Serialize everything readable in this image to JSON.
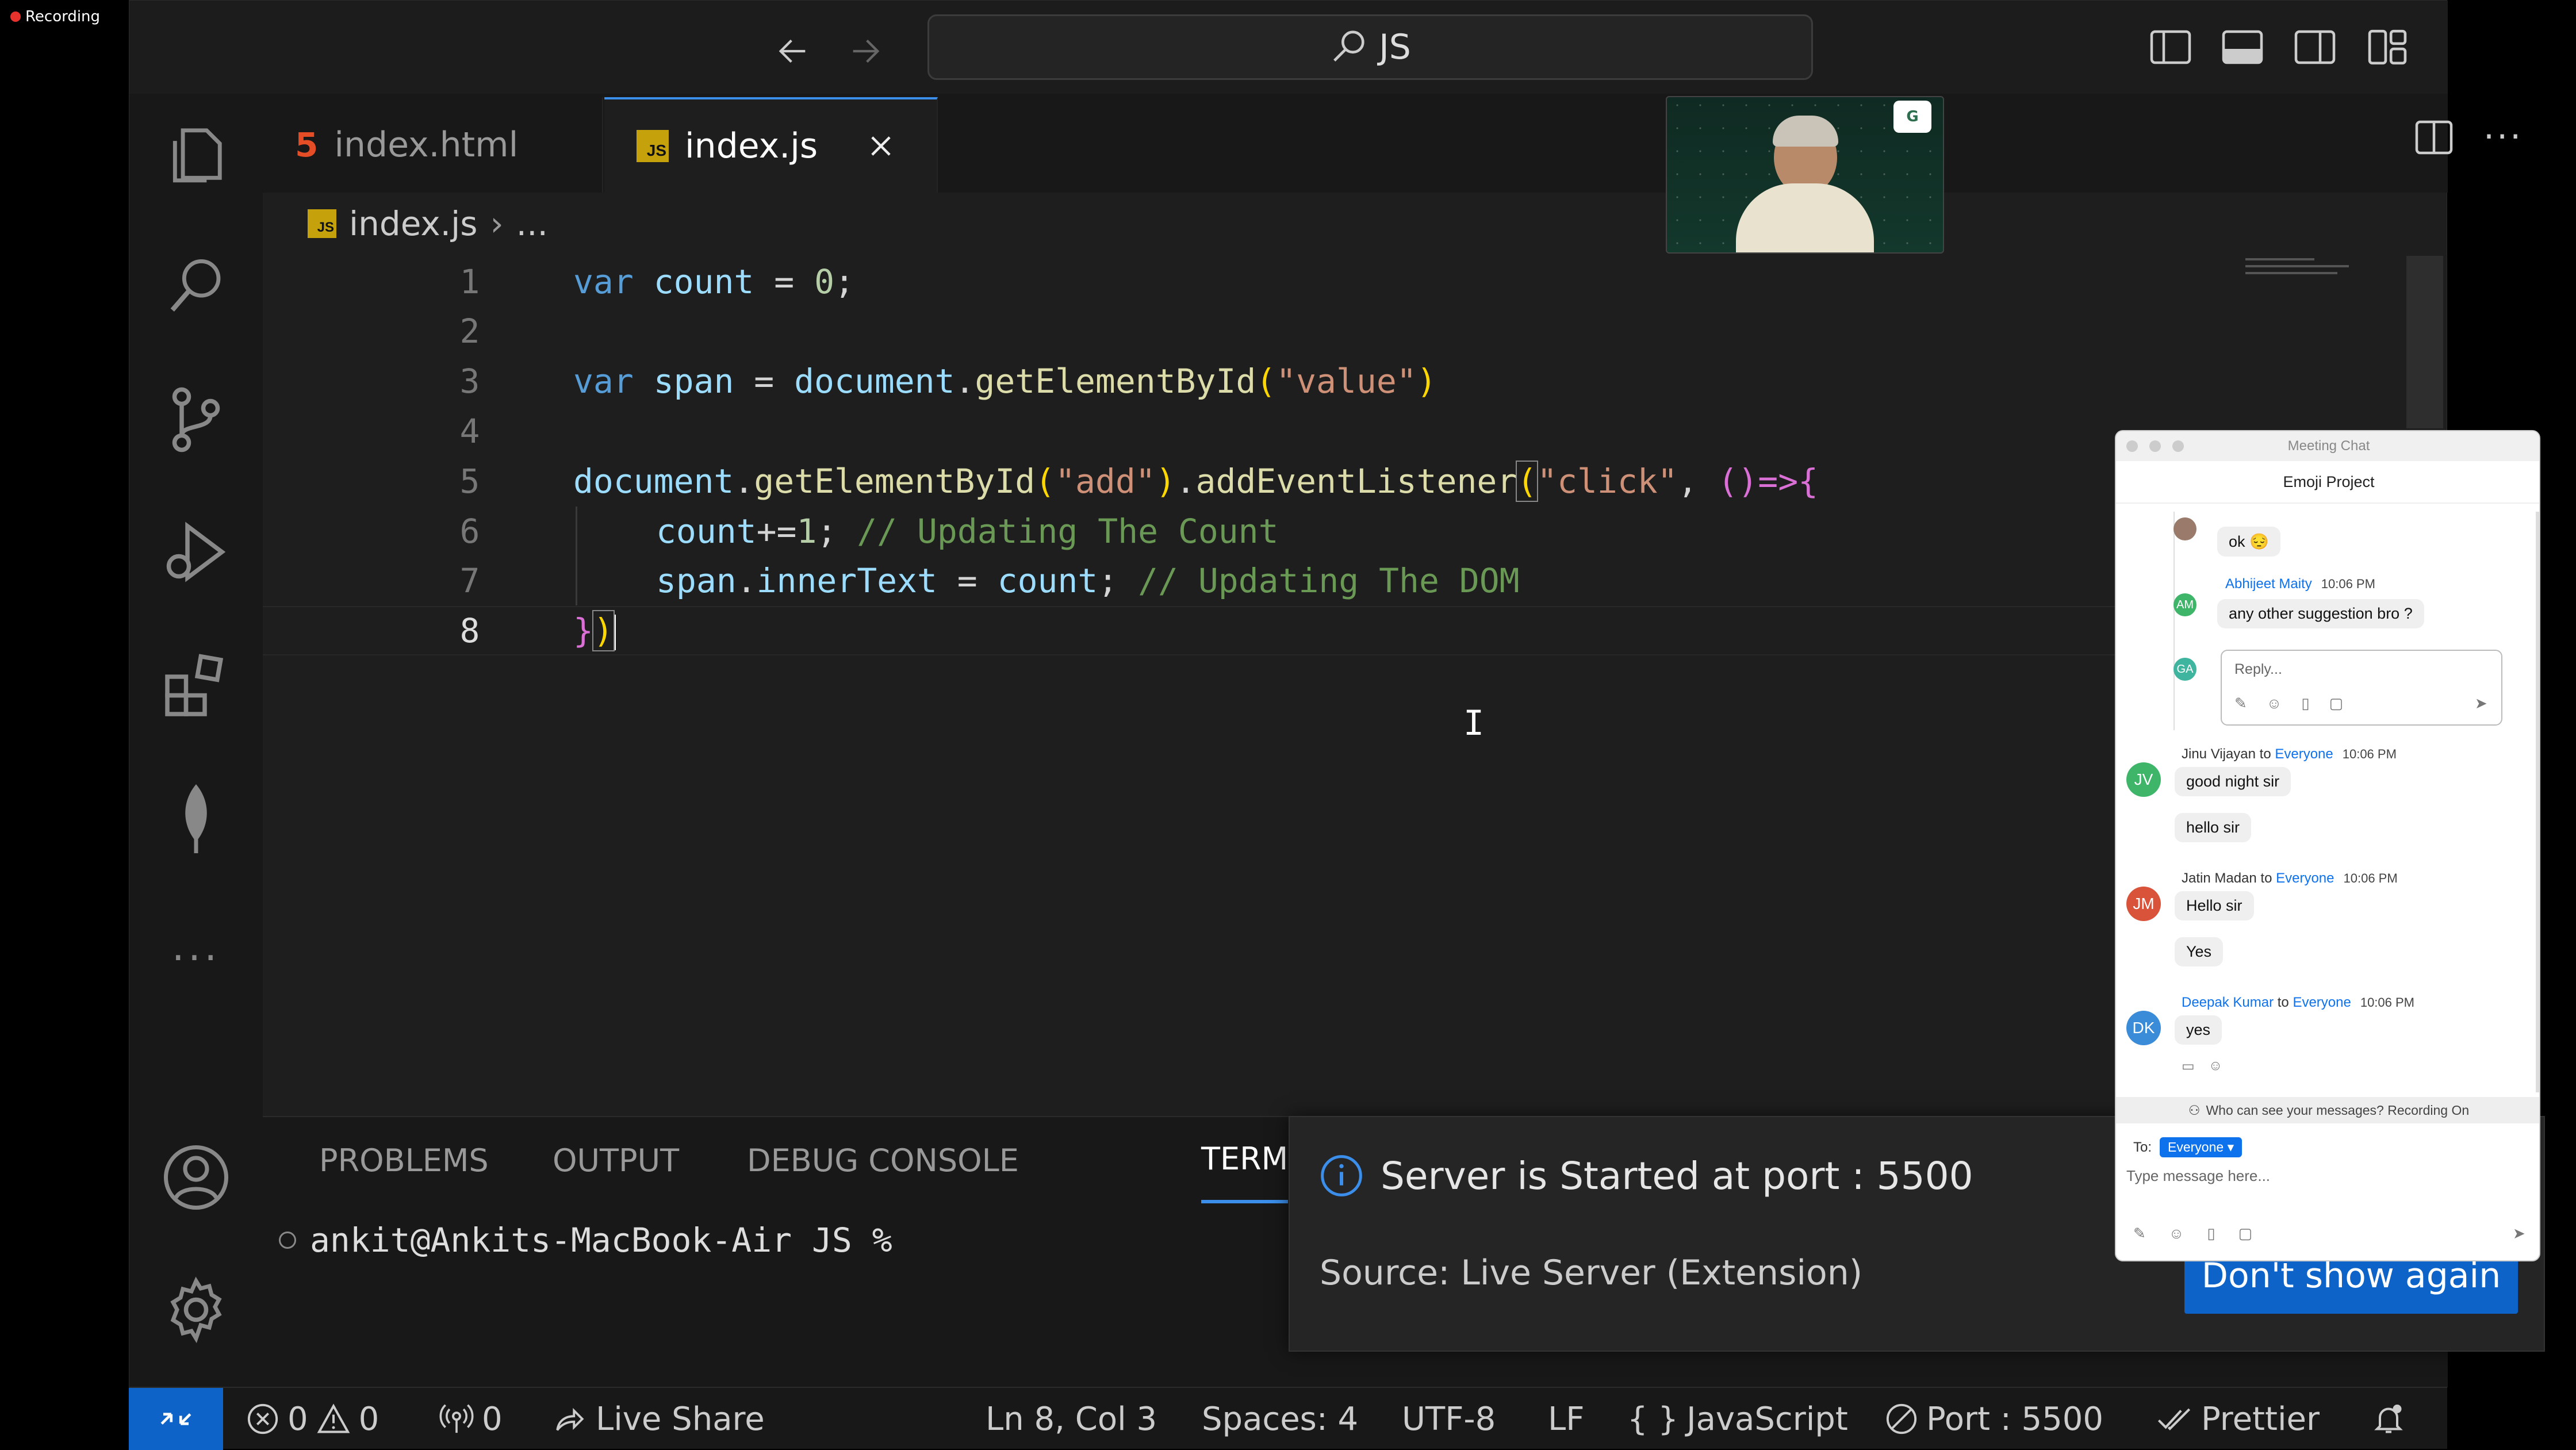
{
  "recording": {
    "label": "Recording"
  },
  "titlebar": {
    "search_text": "JS"
  },
  "tabs": [
    {
      "label": "index.html",
      "icon": "html5-icon"
    },
    {
      "label": "index.js",
      "icon": "js-icon",
      "active": true
    }
  ],
  "breadcrumb": {
    "file": "index.js",
    "more": "..."
  },
  "editor": {
    "lines": [
      {
        "n": "1"
      },
      {
        "n": "2"
      },
      {
        "n": "3"
      },
      {
        "n": "4"
      },
      {
        "n": "5"
      },
      {
        "n": "6"
      },
      {
        "n": "7"
      },
      {
        "n": "8"
      }
    ],
    "code": {
      "l1_kw": "var",
      "l1_name": "count",
      "l1_rest": " = ",
      "l1_num": "0",
      "l1_end": ";",
      "l3_kw": "var",
      "l3_name": "span",
      "l3_eq": " = ",
      "l3_obj": "document",
      "l3_dot": ".",
      "l3_fn": "getElementById",
      "l3_open": "(",
      "l3_str": "\"value\"",
      "l3_close": ")",
      "l5_obj": "document",
      "l5_dot": ".",
      "l5_fn": "getElementById",
      "l5_open": "(",
      "l5_str": "\"add\"",
      "l5_close": ")",
      "l5_dot2": ".",
      "l5_fn2": "addEventListener",
      "l5_open2": "(",
      "l5_str2": "\"click\"",
      "l5_comma": ", ",
      "l5_arrow": "()=>",
      "l5_brace": "{",
      "l6_name": "count",
      "l6_op": "+=",
      "l6_num": "1",
      "l6_semi": "; ",
      "l6_cm": "// Updating The Count",
      "l7_obj": "span",
      "l7_dot": ".",
      "l7_prop": "innerText",
      "l7_eq": " = ",
      "l7_name": "count",
      "l7_semi": "; ",
      "l7_cm": "// Updating The DOM",
      "l8_brace": "}",
      "l8_paren": ")"
    }
  },
  "panel": {
    "tabs": [
      "PROBLEMS",
      "OUTPUT",
      "DEBUG CONSOLE",
      "TERM"
    ],
    "terminal_prompt": "ankit@Ankits-MacBook-Air JS %"
  },
  "notification": {
    "message": "Server is Started at port : 5500",
    "source": "Source: Live Server (Extension)",
    "button": "Don't show again"
  },
  "statusbar": {
    "errors": "0",
    "warnings": "0",
    "ports": "0",
    "live_share": "Live Share",
    "position": "Ln 8, Col 3",
    "spaces": "Spaces: 4",
    "encoding": "UTF-8",
    "eol": "LF",
    "language_icon": "{ }",
    "language": "JavaScript",
    "port": "Port : 5500",
    "prettier": "Prettier"
  },
  "chat": {
    "window_title": "Meeting Chat",
    "title": "Emoji Project",
    "thread": [
      {
        "text": "ok 😔"
      },
      {
        "name": "Abhijeet Maity",
        "time": "10:06 PM",
        "initials": "AM",
        "text": "any other suggestion bro ?"
      }
    ],
    "reply_initials": "GA",
    "reply_placeholder": "Reply...",
    "messages": [
      {
        "initials": "JV",
        "name": "Jinu Vijayan",
        "to": "to",
        "target": "Everyone",
        "time": "10:06 PM",
        "texts": [
          "good night sir",
          "hello sir"
        ],
        "color": "#3fb56a"
      },
      {
        "initials": "JM",
        "name": "Jatin Madan",
        "to": "to",
        "target": "Everyone",
        "time": "10:06 PM",
        "texts": [
          "Hello sir",
          "Yes"
        ],
        "color": "#d8533a"
      },
      {
        "initials": "DK",
        "name": "Deepak Kumar",
        "to": "to",
        "target": "Everyone",
        "time": "10:06 PM",
        "texts": [
          "yes"
        ],
        "color": "#3a8bd8"
      }
    ],
    "privacy": "Who can see your messages? Recording On",
    "to_label": "To:",
    "to_value": "Everyone ▾",
    "input_placeholder": "Type message here..."
  }
}
